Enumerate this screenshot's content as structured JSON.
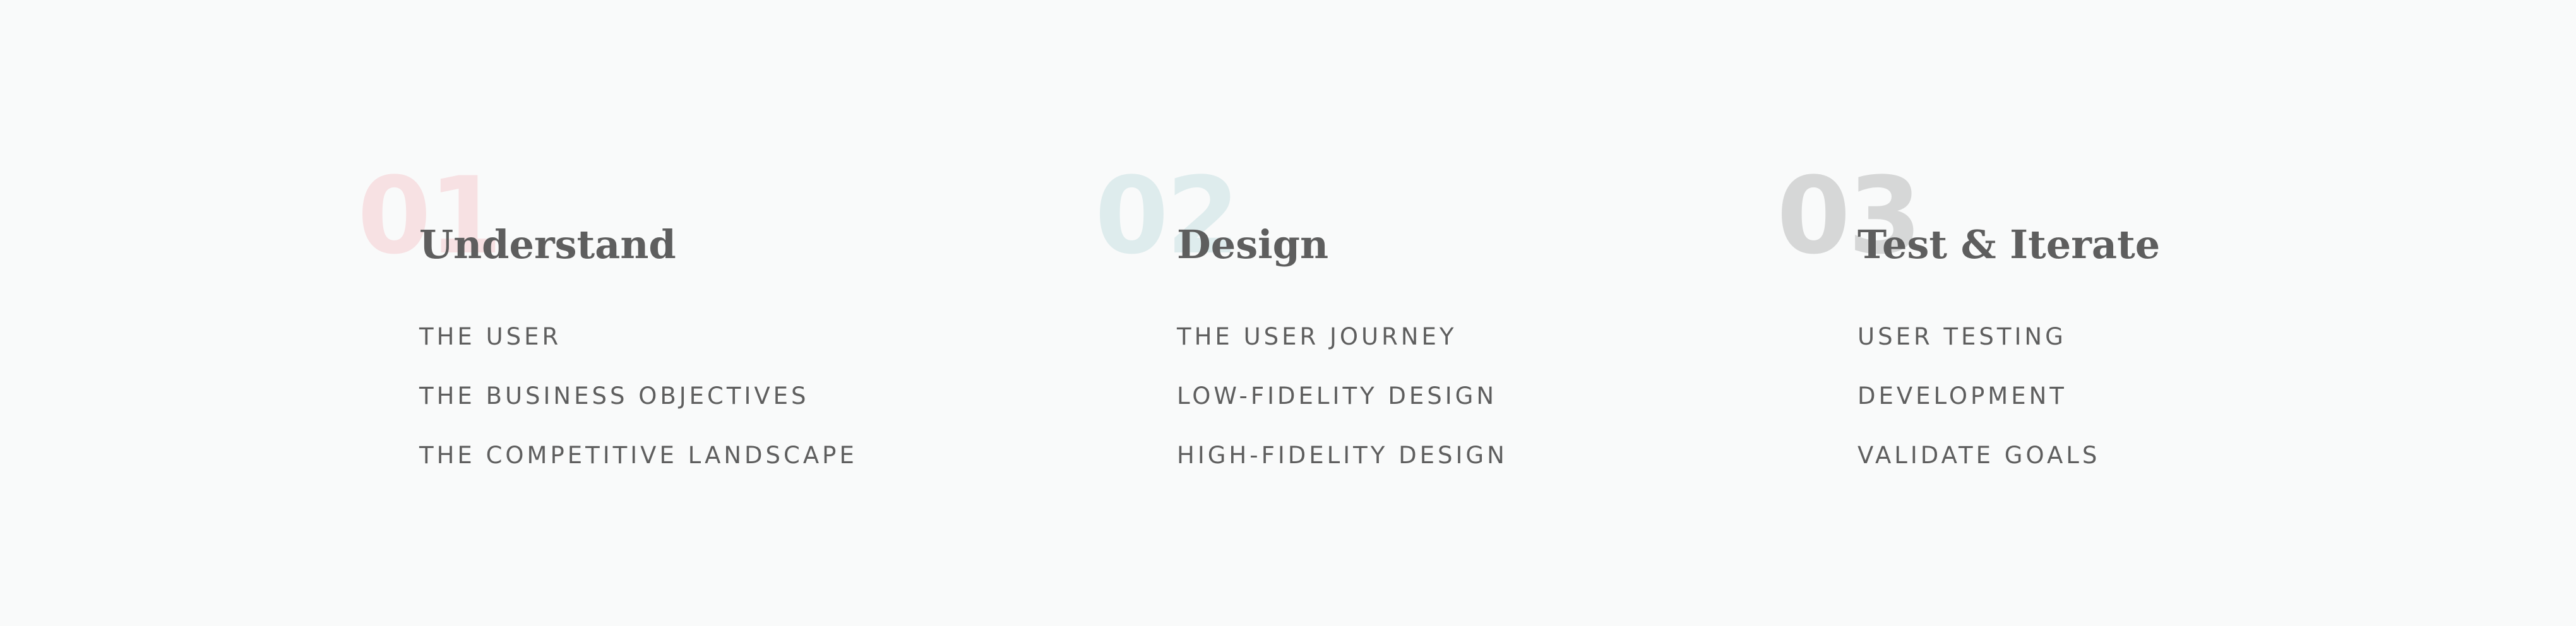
{
  "colors": {
    "background": "#f9fafa",
    "text": "#5e5e5e",
    "number_1": "#f7e1e3",
    "number_2": "#deeced",
    "number_3": "#d6d7d7"
  },
  "steps": [
    {
      "number": "01",
      "title": "Understand",
      "items": [
        "THE USER",
        "THE BUSINESS OBJECTIVES",
        "THE COMPETITIVE LANDSCAPE"
      ]
    },
    {
      "number": "02",
      "title": "Design",
      "items": [
        "THE USER JOURNEY",
        "LOW-FIDELITY DESIGN",
        "HIGH-FIDELITY DESIGN"
      ]
    },
    {
      "number": "03",
      "title": "Test & Iterate",
      "items": [
        "USER TESTING",
        "DEVELOPMENT",
        "VALIDATE GOALS"
      ]
    }
  ]
}
